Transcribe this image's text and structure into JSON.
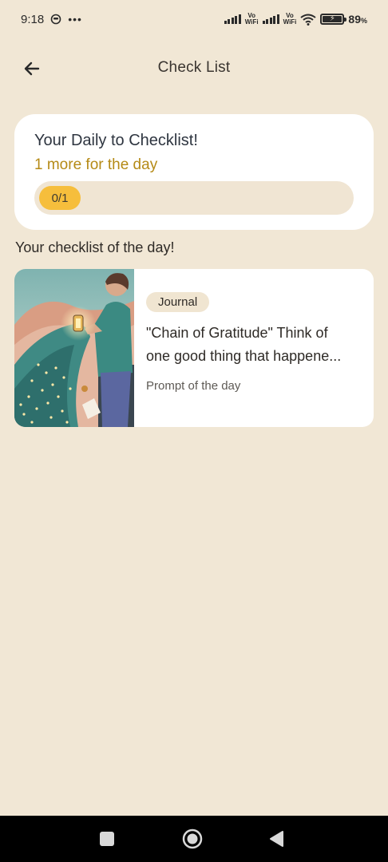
{
  "status_bar": {
    "time": "9:18",
    "battery": "89",
    "battery_unit": "%",
    "network_label_top": "Vo",
    "network_label_bottom": "WiFi"
  },
  "header": {
    "title": "Check List",
    "back_icon": "arrow-left-icon"
  },
  "progress": {
    "title": "Your Daily to Checklist!",
    "subtitle": "1 more for the day",
    "count_label": "0/1",
    "completed": 0,
    "total": 1,
    "accent_color": "#f6be3c",
    "subtitle_color": "#b58a16"
  },
  "checklist": {
    "heading": "Your checklist of the day!",
    "items": [
      {
        "tag": "Journal",
        "text_line1": "\"Chain of Gratitude\" Think of",
        "text_line2": "one good thing that happene...",
        "meta": "Prompt of the day"
      }
    ]
  },
  "nav": {
    "square_icon": "recents-square-icon",
    "home_icon": "home-circle-icon",
    "back_icon": "back-triangle-icon"
  },
  "colors": {
    "background": "#f1e7d5",
    "card": "#ffffff",
    "tag_bg": "#f0e5d1"
  }
}
